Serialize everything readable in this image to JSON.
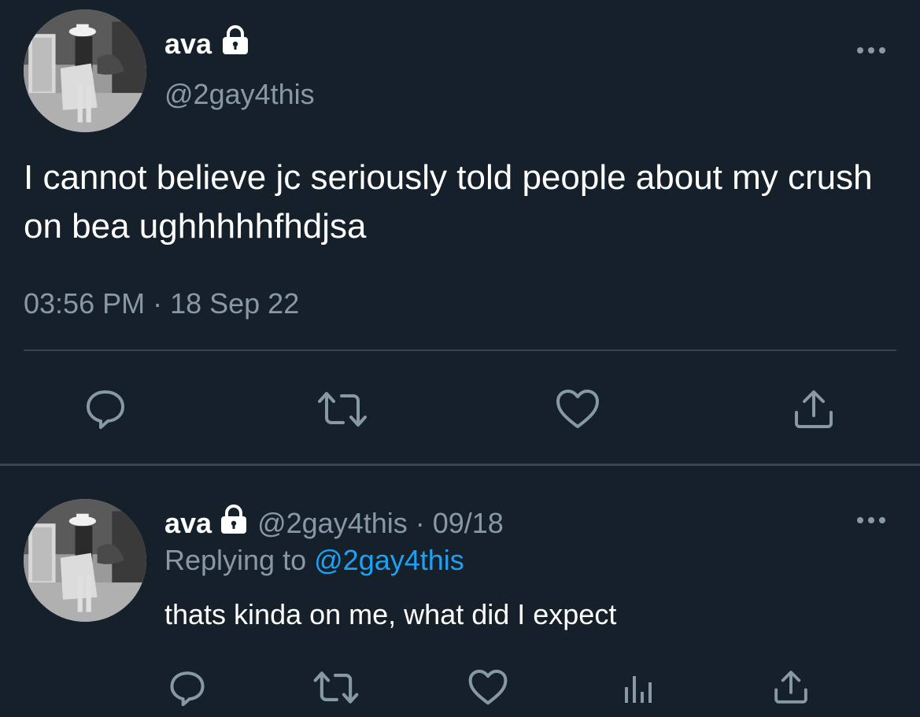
{
  "main_tweet": {
    "display_name": "ava",
    "handle": "@2gay4this",
    "protected_icon": "lock-icon",
    "more_icon": "more-dots-icon",
    "text": "I cannot believe jc seriously told people about my crush on bea ughhhhhfhdjsa",
    "timestamp": "03:56 PM · 18 Sep 22",
    "actions": [
      "reply-icon",
      "retweet-icon",
      "like-icon",
      "share-icon"
    ]
  },
  "reply_tweet": {
    "display_name": "ava",
    "handle_and_date": "@2gay4this · 09/18",
    "replying_to_label": "Replying to",
    "replying_to_handle": "@2gay4this",
    "text": "thats kinda on me, what did I expect",
    "protected_icon": "lock-icon",
    "more_icon": "more-dots-icon",
    "actions": [
      "reply-icon",
      "retweet-icon",
      "like-icon",
      "analytics-icon",
      "share-icon"
    ]
  },
  "colors": {
    "background": "#15202b",
    "primary_text": "#ffffff",
    "secondary_text": "#8899a6",
    "divider": "#38444d",
    "link": "#1da1f2"
  }
}
